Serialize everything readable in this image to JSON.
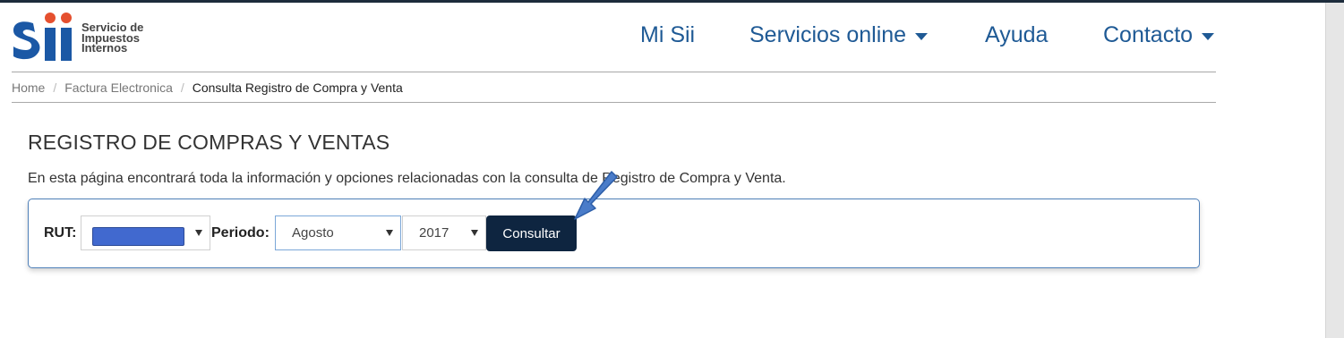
{
  "logo": {
    "text_lines": [
      "Servicio de",
      "Impuestos",
      "Internos"
    ]
  },
  "nav": [
    {
      "label": "Mi Sii"
    },
    {
      "label": "Servicios online"
    },
    {
      "label": "Ayuda"
    },
    {
      "label": "Contacto"
    }
  ],
  "breadcrumb": {
    "home": "Home",
    "section": "Factura Electronica",
    "current": "Consulta Registro de Compra y Venta",
    "separator": "/"
  },
  "page": {
    "title": "REGISTRO DE COMPRAS Y VENTAS",
    "description": "En esta página encontrará toda la información y opciones relacionadas con la consulta de Registro de Compra y Venta."
  },
  "form": {
    "rut_label": "RUT:",
    "periodo_label": "Periodo:",
    "month_selected": "Agosto",
    "year_selected": "2017",
    "submit_label": "Consultar"
  },
  "colors": {
    "nav_text": "#1f5a95",
    "logo_blue": "#1b58a5",
    "logo_red": "#e5502f",
    "button_bg": "#0e2540",
    "panel_border": "#4f80b9",
    "annotation_arrow": "#4a7cc9"
  }
}
